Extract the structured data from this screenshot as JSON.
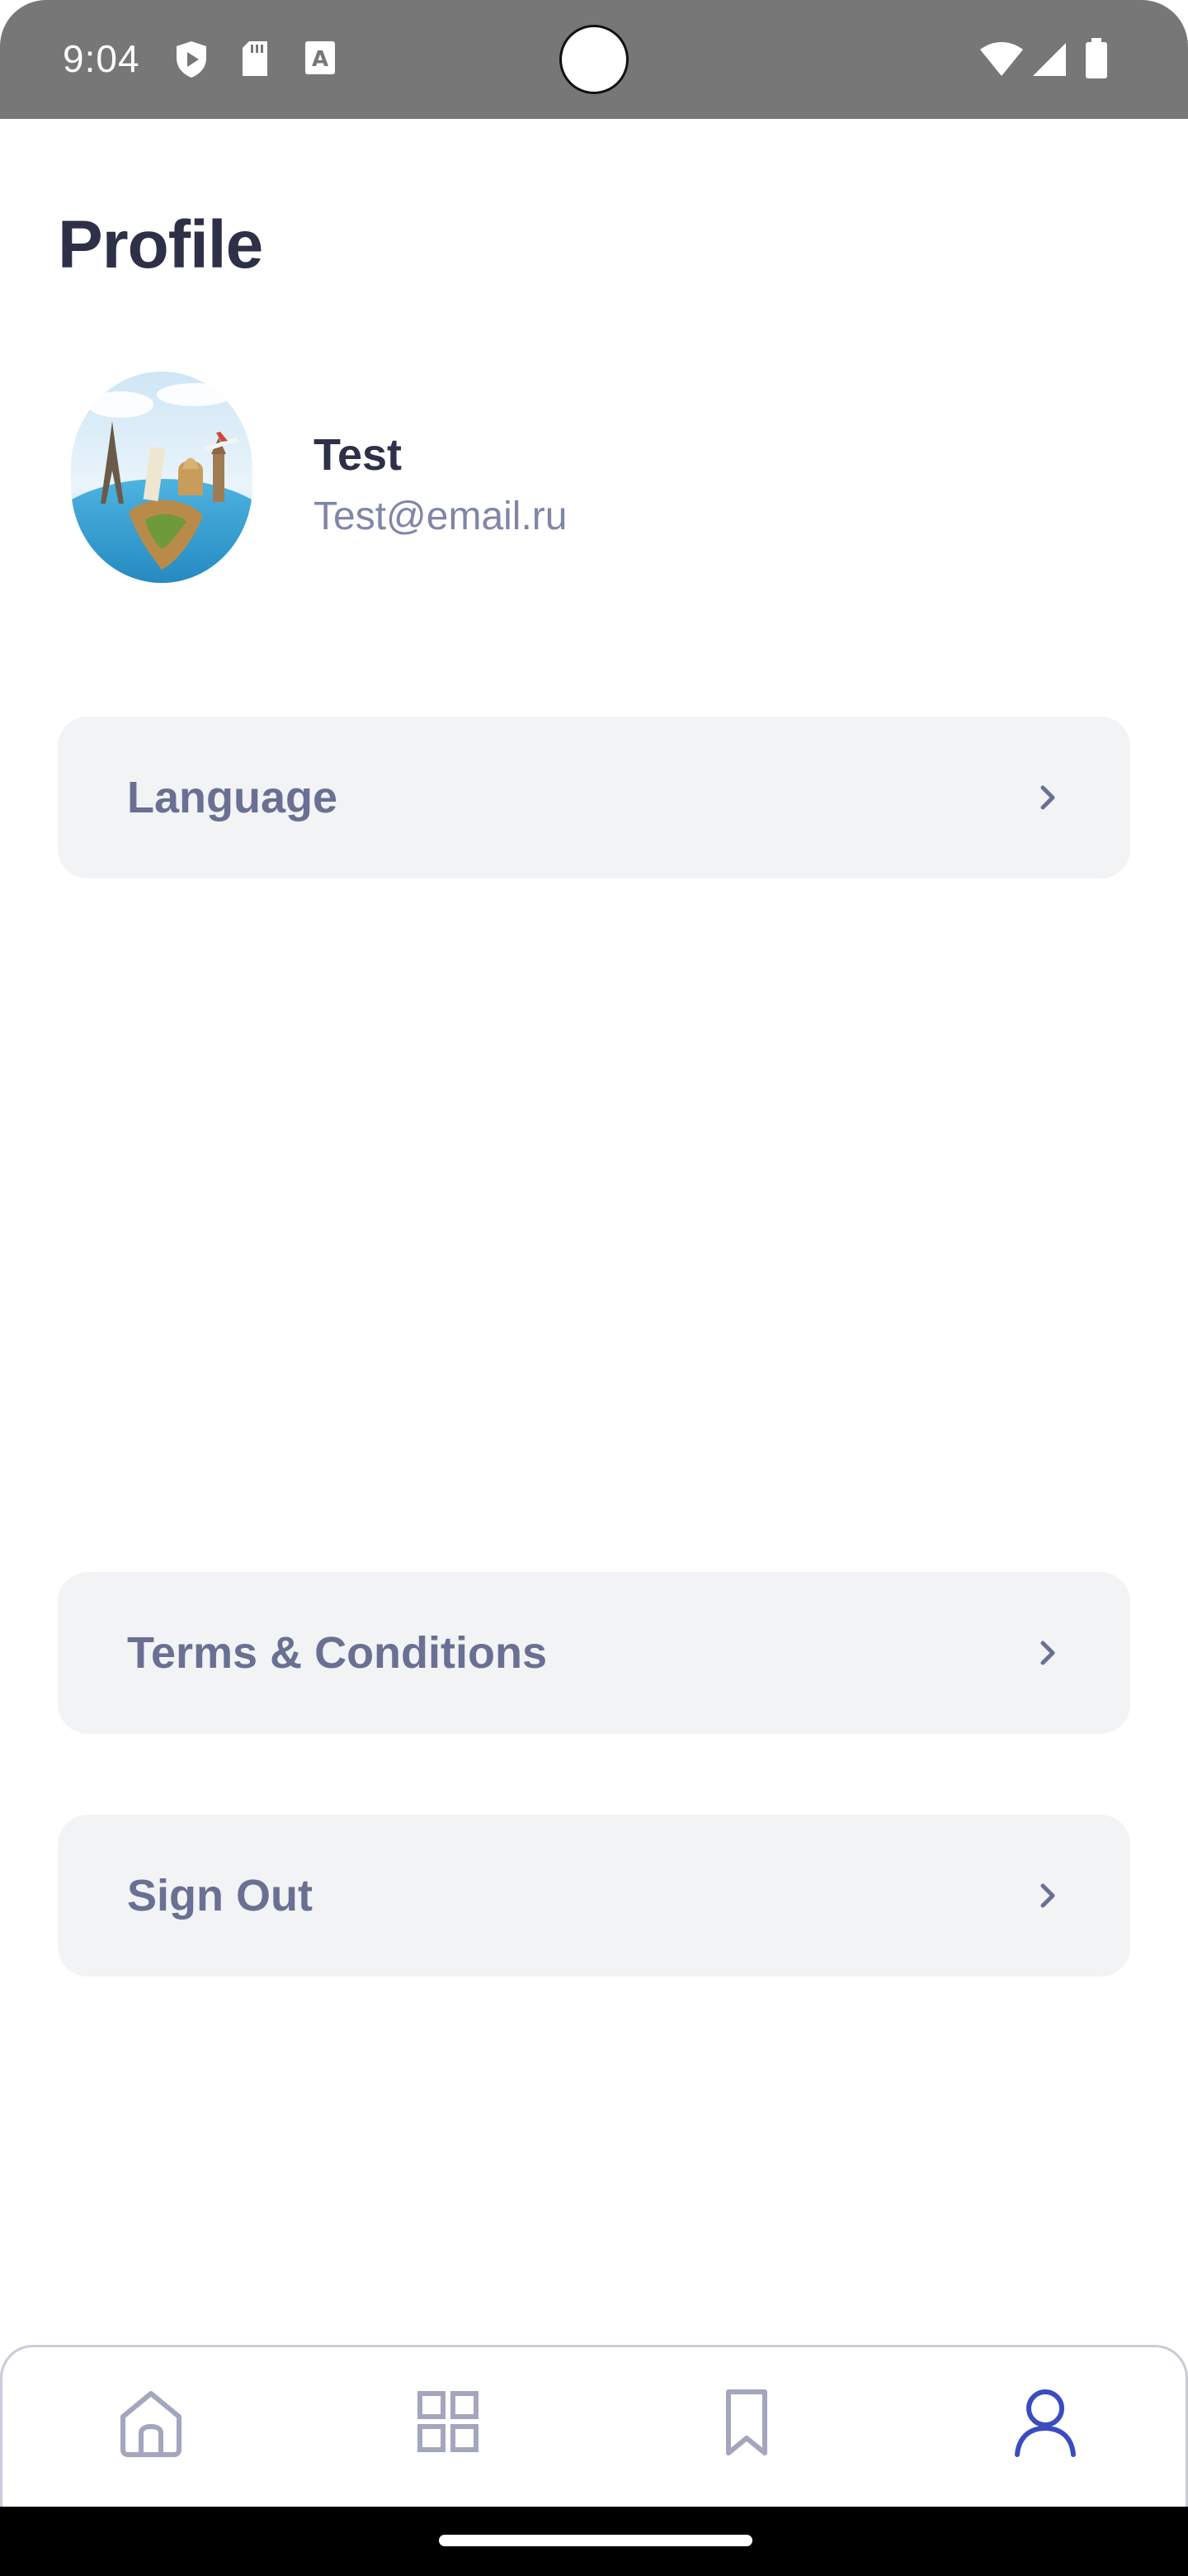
{
  "status_bar": {
    "time": "9:04",
    "icons": [
      "shield-play-icon",
      "sd-card-icon",
      "keyboard-a-icon",
      "wifi-icon",
      "cell-signal-icon",
      "battery-icon"
    ]
  },
  "header": {
    "title": "Profile"
  },
  "profile": {
    "name": "Test",
    "email": "Test@email.ru",
    "avatar": "travel-landmarks-globe"
  },
  "menu": [
    {
      "label": "Language"
    },
    {
      "label": "Terms & Conditions"
    },
    {
      "label": "Sign Out"
    }
  ],
  "bottom_nav": {
    "items": [
      {
        "icon": "home-icon",
        "active": false
      },
      {
        "icon": "grid-icon",
        "active": false
      },
      {
        "icon": "bookmark-icon",
        "active": false
      },
      {
        "icon": "user-icon",
        "active": true
      }
    ],
    "active_color": "#3b4cc0",
    "inactive_color": "#a3a6bd"
  },
  "colors": {
    "title": "#2d3047",
    "muted_text": "#7f86a6",
    "card_bg": "#f2f3f5",
    "card_text": "#6a7093"
  }
}
